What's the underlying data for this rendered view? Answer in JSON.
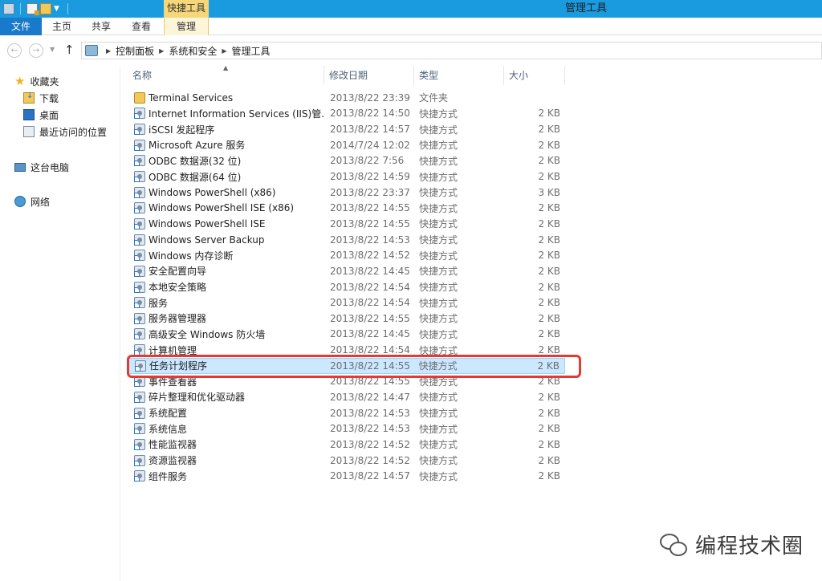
{
  "titlebar": {
    "context_header": "快捷工具",
    "window_title": "管理工具"
  },
  "ribbon": {
    "tabs": [
      "文件",
      "主页",
      "共享",
      "查看",
      "管理"
    ]
  },
  "address": {
    "crumbs": [
      "控制面板",
      "系统和安全",
      "管理工具"
    ]
  },
  "navpane": {
    "favorites": "收藏夹",
    "downloads": "下载",
    "desktop": "桌面",
    "recent": "最近访问的位置",
    "this_pc": "这台电脑",
    "network": "网络"
  },
  "columns": {
    "name": "名称",
    "date": "修改日期",
    "type": "类型",
    "size": "大小"
  },
  "files": [
    {
      "name": "Terminal Services",
      "date": "2013/8/22 23:39",
      "type": "文件夹",
      "size": "",
      "icon": "folder-icon"
    },
    {
      "name": "Internet Information Services (IIS)管...",
      "date": "2013/8/22 14:50",
      "type": "快捷方式",
      "size": "2 KB",
      "icon": "iis-icon"
    },
    {
      "name": "iSCSI 发起程序",
      "date": "2013/8/22 14:57",
      "type": "快捷方式",
      "size": "2 KB",
      "icon": "iscsi-icon"
    },
    {
      "name": "Microsoft Azure 服务",
      "date": "2014/7/24 12:02",
      "type": "快捷方式",
      "size": "2 KB",
      "icon": "azure-icon"
    },
    {
      "name": "ODBC 数据源(32 位)",
      "date": "2013/8/22 7:56",
      "type": "快捷方式",
      "size": "2 KB",
      "icon": "odbc-icon"
    },
    {
      "name": "ODBC 数据源(64 位)",
      "date": "2013/8/22 14:59",
      "type": "快捷方式",
      "size": "2 KB",
      "icon": "odbc-icon"
    },
    {
      "name": "Windows PowerShell (x86)",
      "date": "2013/8/22 23:37",
      "type": "快捷方式",
      "size": "3 KB",
      "icon": "powershell-icon"
    },
    {
      "name": "Windows PowerShell ISE (x86)",
      "date": "2013/8/22 14:55",
      "type": "快捷方式",
      "size": "2 KB",
      "icon": "powershell-ise-icon"
    },
    {
      "name": "Windows PowerShell ISE",
      "date": "2013/8/22 14:55",
      "type": "快捷方式",
      "size": "2 KB",
      "icon": "powershell-ise-icon"
    },
    {
      "name": "Windows Server Backup",
      "date": "2013/8/22 14:53",
      "type": "快捷方式",
      "size": "2 KB",
      "icon": "backup-icon"
    },
    {
      "name": "Windows 内存诊断",
      "date": "2013/8/22 14:52",
      "type": "快捷方式",
      "size": "2 KB",
      "icon": "memory-diagnostic-icon"
    },
    {
      "name": "安全配置向导",
      "date": "2013/8/22 14:45",
      "type": "快捷方式",
      "size": "2 KB",
      "icon": "security-wizard-icon"
    },
    {
      "name": "本地安全策略",
      "date": "2013/8/22 14:54",
      "type": "快捷方式",
      "size": "2 KB",
      "icon": "security-policy-icon"
    },
    {
      "name": "服务",
      "date": "2013/8/22 14:54",
      "type": "快捷方式",
      "size": "2 KB",
      "icon": "services-icon"
    },
    {
      "name": "服务器管理器",
      "date": "2013/8/22 14:55",
      "type": "快捷方式",
      "size": "2 KB",
      "icon": "server-manager-icon"
    },
    {
      "name": "高级安全 Windows 防火墙",
      "date": "2013/8/22 14:45",
      "type": "快捷方式",
      "size": "2 KB",
      "icon": "firewall-icon"
    },
    {
      "name": "计算机管理",
      "date": "2013/8/22 14:54",
      "type": "快捷方式",
      "size": "2 KB",
      "icon": "computer-management-icon"
    },
    {
      "name": "任务计划程序",
      "date": "2013/8/22 14:55",
      "type": "快捷方式",
      "size": "2 KB",
      "icon": "task-scheduler-icon",
      "selected": true
    },
    {
      "name": "事件查看器",
      "date": "2013/8/22 14:55",
      "type": "快捷方式",
      "size": "2 KB",
      "icon": "event-viewer-icon"
    },
    {
      "name": "碎片整理和优化驱动器",
      "date": "2013/8/22 14:47",
      "type": "快捷方式",
      "size": "2 KB",
      "icon": "defrag-icon"
    },
    {
      "name": "系统配置",
      "date": "2013/8/22 14:53",
      "type": "快捷方式",
      "size": "2 KB",
      "icon": "system-config-icon"
    },
    {
      "name": "系统信息",
      "date": "2013/8/22 14:53",
      "type": "快捷方式",
      "size": "2 KB",
      "icon": "system-info-icon"
    },
    {
      "name": "性能监视器",
      "date": "2013/8/22 14:52",
      "type": "快捷方式",
      "size": "2 KB",
      "icon": "performance-monitor-icon"
    },
    {
      "name": "资源监视器",
      "date": "2013/8/22 14:52",
      "type": "快捷方式",
      "size": "2 KB",
      "icon": "resource-monitor-icon"
    },
    {
      "name": "组件服务",
      "date": "2013/8/22 14:57",
      "type": "快捷方式",
      "size": "2 KB",
      "icon": "component-services-icon"
    }
  ],
  "watermark": "编程技术圈",
  "colors": {
    "titlebar": "#1a9be0",
    "file_tab": "#1979ca",
    "context_tab": "#f5d77a",
    "selection": "#cce8ff",
    "highlight_box": "#e53935"
  }
}
